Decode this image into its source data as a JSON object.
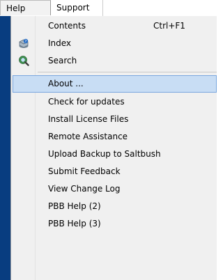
{
  "menubar": {
    "items": [
      {
        "label": "Help"
      },
      {
        "label": "Support"
      }
    ]
  },
  "menu": {
    "items": [
      {
        "label": "Contents",
        "shortcut": "Ctrl+F1",
        "icon": ""
      },
      {
        "label": "Index",
        "shortcut": "",
        "icon": "help-book-icon"
      },
      {
        "label": "Search",
        "shortcut": "",
        "icon": "search-globe-icon"
      },
      {
        "label": "About ...",
        "shortcut": "",
        "icon": "",
        "selected": true
      },
      {
        "label": "Check for updates",
        "shortcut": "",
        "icon": ""
      },
      {
        "label": "Install License Files",
        "shortcut": "",
        "icon": ""
      },
      {
        "label": "Remote Assistance",
        "shortcut": "",
        "icon": ""
      },
      {
        "label": "Upload Backup to Saltbush",
        "shortcut": "",
        "icon": ""
      },
      {
        "label": "Submit Feedback",
        "shortcut": "",
        "icon": ""
      },
      {
        "label": "View Change Log",
        "shortcut": "",
        "icon": ""
      },
      {
        "label": "PBB Help (2)",
        "shortcut": "",
        "icon": ""
      },
      {
        "label": "PBB Help (3)",
        "shortcut": "",
        "icon": ""
      }
    ]
  },
  "colors": {
    "selection_bg": "#c8ddf4",
    "selection_border": "#7aa7de",
    "menu_bg": "#f0f0f0",
    "app_edge": "#083d80"
  }
}
